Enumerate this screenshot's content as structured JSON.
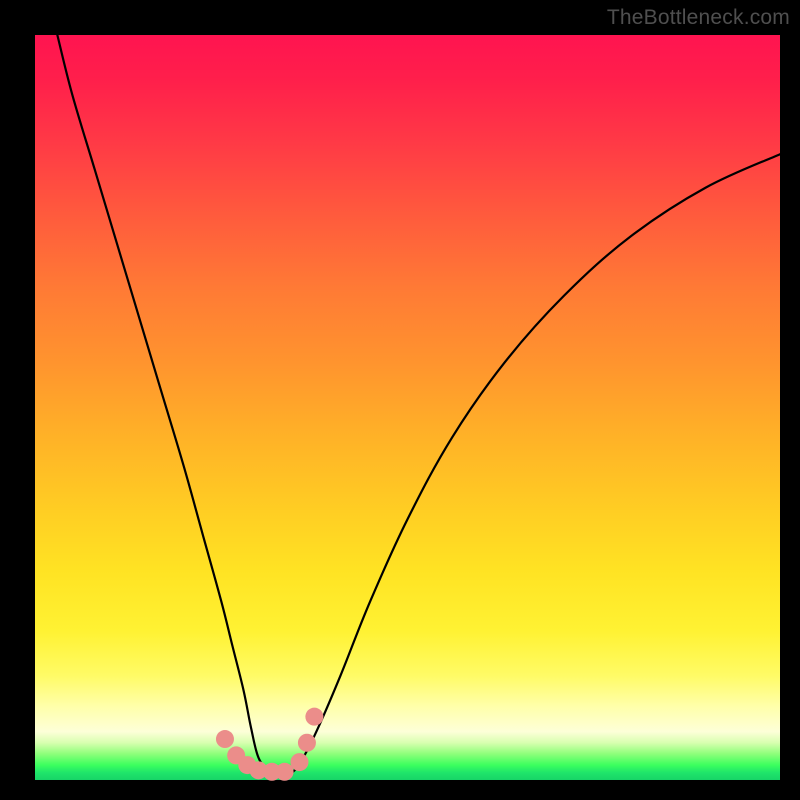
{
  "watermark": "TheBottleneck.com",
  "chart_data": {
    "type": "line",
    "title": "",
    "xlabel": "",
    "ylabel": "",
    "xlim": [
      0,
      100
    ],
    "ylim": [
      0,
      100
    ],
    "series": [
      {
        "name": "bottleneck-curve",
        "x": [
          3,
          5,
          8,
          11,
          14,
          17,
          20,
          22.5,
          25,
          26.5,
          28,
          29,
          30,
          31.5,
          33,
          34.5,
          36,
          38,
          41,
          45,
          50,
          56,
          63,
          71,
          80,
          90,
          100
        ],
        "values": [
          100,
          92,
          82,
          72,
          62,
          52,
          42,
          33,
          24,
          18,
          12,
          7,
          3,
          1,
          0.7,
          1,
          3,
          7,
          14,
          24,
          35,
          46,
          56,
          65,
          73,
          79.5,
          84
        ]
      }
    ],
    "markers": [
      {
        "x": 25.5,
        "y": 5.5
      },
      {
        "x": 27.0,
        "y": 3.3
      },
      {
        "x": 28.5,
        "y": 2.0
      },
      {
        "x": 30.0,
        "y": 1.3
      },
      {
        "x": 31.8,
        "y": 1.1
      },
      {
        "x": 33.5,
        "y": 1.1
      },
      {
        "x": 35.5,
        "y": 2.4
      },
      {
        "x": 36.5,
        "y": 5.0
      },
      {
        "x": 37.5,
        "y": 8.5
      }
    ],
    "marker_color": "#eb8d8a",
    "curve_color": "#000000"
  }
}
